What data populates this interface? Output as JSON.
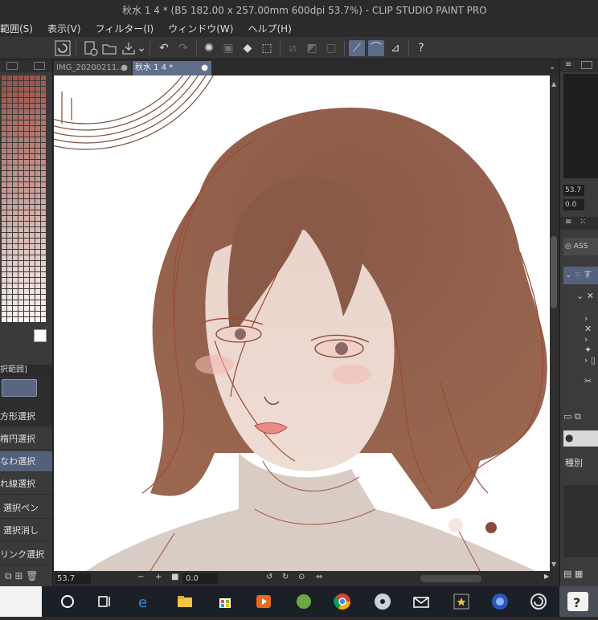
{
  "window": {
    "title": "秋水 1 4 * (B5 182.00 x 257.00mm 600dpi 53.7%)  - CLIP STUDIO PAINT PRO"
  },
  "menu": [
    "範囲(S)",
    "表示(V)",
    "フィルター(I)",
    "ウィンドウ(W)",
    "ヘルプ(H)"
  ],
  "tabs": [
    {
      "label": "IMG_20200211..."
    },
    {
      "label": "秋水 1 4 *"
    }
  ],
  "left_panel": {
    "section_label": "択範囲]",
    "selection_tools": [
      "方形選択",
      "楕円選択",
      "なわ選択",
      "れ線選択",
      "選択ペン",
      "選択消し",
      "リンク選択"
    ],
    "active_index": 2
  },
  "status": {
    "zoom": "53.7",
    "angle": "0.0"
  },
  "right_panel": {
    "zoom": "53.7",
    "angle": "0.0",
    "assets_label": "ASS",
    "tree_label": "す",
    "kind_label": "種別"
  },
  "colors": {
    "accent": "#5b6c8a",
    "hair": "#8d5846",
    "skin": "#ecd6cc",
    "line": "#a0412f"
  }
}
